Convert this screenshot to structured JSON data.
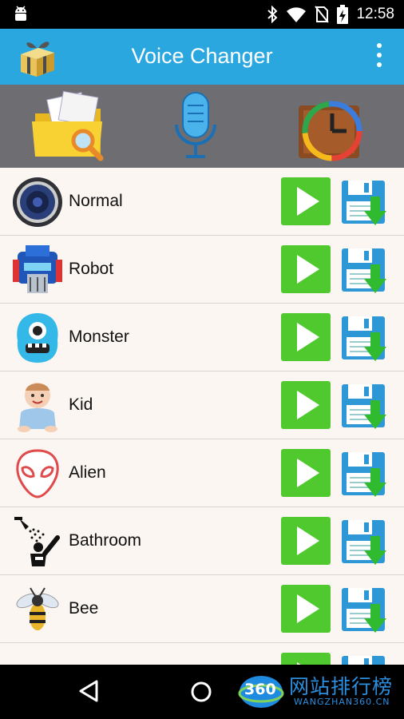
{
  "status_bar": {
    "time": "12:58",
    "icons": [
      "android-icon",
      "bluetooth-icon",
      "wifi-icon",
      "no-sim-icon",
      "battery-charging-icon"
    ]
  },
  "app_bar": {
    "title": "Voice Changer",
    "logo_icon": "gift-box-icon",
    "menu_icon": "overflow-menu-icon",
    "color": "#2ba7e0"
  },
  "toolbar": {
    "items": [
      {
        "icon": "folder-search-icon"
      },
      {
        "icon": "microphone-icon"
      },
      {
        "icon": "recent-clock-icon"
      }
    ]
  },
  "voices": [
    {
      "label": "Normal",
      "icon": "speaker-icon"
    },
    {
      "label": "Robot",
      "icon": "robot-icon"
    },
    {
      "label": "Monster",
      "icon": "monster-icon"
    },
    {
      "label": "Kid",
      "icon": "baby-icon"
    },
    {
      "label": "Alien",
      "icon": "alien-icon"
    },
    {
      "label": "Bathroom",
      "icon": "shower-icon"
    },
    {
      "label": "Bee",
      "icon": "bee-icon"
    }
  ],
  "actions": {
    "play_icon": "play-icon",
    "save_icon": "save-download-icon",
    "play_color": "#4fc92d",
    "save_color": "#2e98d6"
  },
  "nav_bar": {
    "icons": [
      "back-icon",
      "home-icon"
    ]
  },
  "watermark": {
    "badge": "360",
    "text": "网站排行榜",
    "subtext": "WANGZHAN360.CN"
  }
}
